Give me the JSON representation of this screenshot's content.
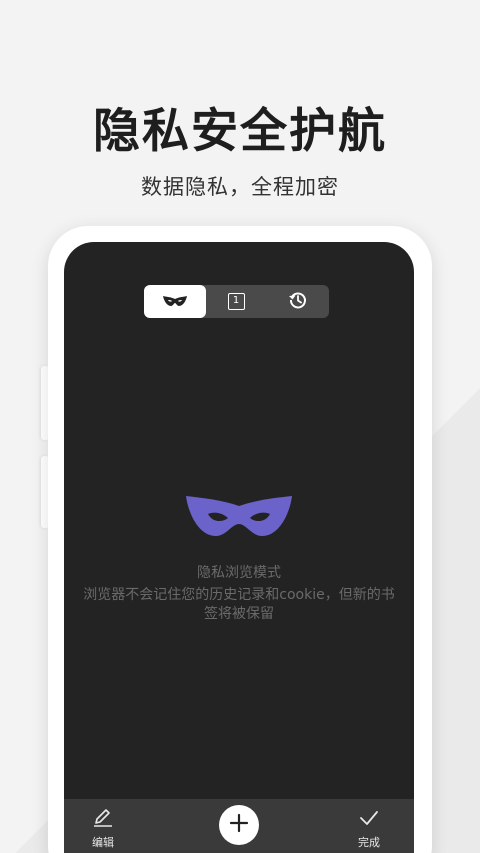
{
  "promo": {
    "headline": "隐私安全护航",
    "subline": "数据隐私，全程加密"
  },
  "tabs": [
    {
      "name": "private-mode",
      "icon": "mask-icon",
      "active": true
    },
    {
      "name": "tabs-count",
      "icon": "tab-count-icon",
      "count": "1",
      "active": false
    },
    {
      "name": "history",
      "icon": "history-icon",
      "active": false
    }
  ],
  "private_mode": {
    "title": "隐私浏览模式",
    "description": "浏览器不会记住您的历史记录和cookie，但新的书签将被保留",
    "icon": "mask-icon",
    "icon_color": "#6b63c9"
  },
  "bottom_bar": {
    "edit_label": "编辑",
    "done_label": "完成",
    "add_icon": "plus-icon"
  }
}
